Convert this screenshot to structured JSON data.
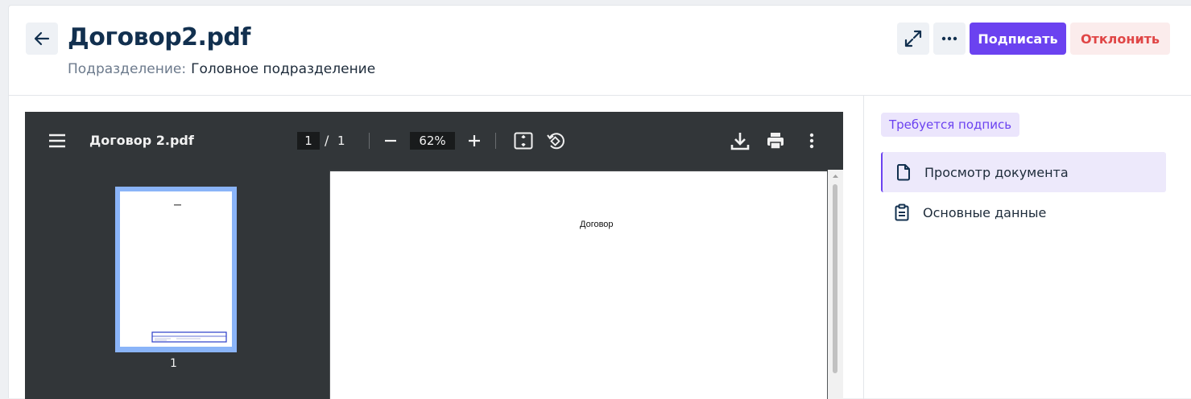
{
  "header": {
    "title": "Договор2.pdf",
    "subdivision_label": "Подразделение:",
    "subdivision_value": "Головное подразделение",
    "sign_label": "Подписать",
    "reject_label": "Отклонить"
  },
  "viewer": {
    "file_name": "Договор 2.pdf",
    "current_page": "1",
    "page_separator": "/",
    "total_pages": "1",
    "zoom": "62%",
    "thumbnail_page": "1",
    "page_text": "Договор"
  },
  "panel": {
    "status_badge": "Требуется подпись",
    "nav": [
      {
        "label": "Просмотр документа",
        "icon": "file-icon",
        "active": true
      },
      {
        "label": "Основные данные",
        "icon": "clipboard-icon",
        "active": false
      }
    ]
  },
  "colors": {
    "accent": "#6b42f0",
    "danger": "#e04646",
    "title": "#12304f"
  }
}
